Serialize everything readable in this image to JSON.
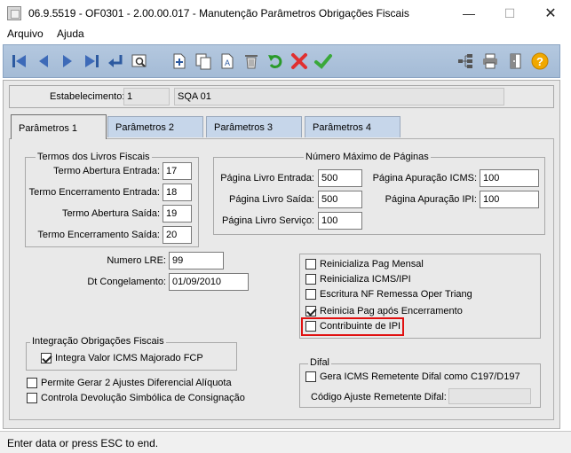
{
  "window": {
    "title": "06.9.5519 - OF0301 - 2.00.00.017 - Manutenção Parâmetros Obrigações Fiscais"
  },
  "menu": {
    "items": [
      "Arquivo",
      "Ajuda"
    ]
  },
  "toolbar": {
    "icons": [
      "first-record-icon",
      "previous-record-icon",
      "next-record-icon",
      "last-record-icon",
      "return-icon",
      "view-icon",
      "new-icon",
      "copy-icon",
      "edit-icon",
      "delete-icon",
      "undo-icon",
      "cancel-icon",
      "confirm-icon",
      "tree-icon",
      "print-icon",
      "exit-icon",
      "help-icon"
    ]
  },
  "header": {
    "estab_label": "Estabelecimento:",
    "estab_code": "1",
    "estab_name": "SQA 01"
  },
  "tabs": [
    {
      "label": "Parâmetros 1"
    },
    {
      "label": "Parâmetros 2"
    },
    {
      "label": "Parâmetros 3"
    },
    {
      "label": "Parâmetros 4"
    }
  ],
  "termos": {
    "title": "Termos dos Livros Fiscais",
    "rows": [
      {
        "label": "Termo Abertura Entrada:",
        "value": "17"
      },
      {
        "label": "Termo Encerramento Entrada:",
        "value": "18"
      },
      {
        "label": "Termo Abertura Saída:",
        "value": "19"
      },
      {
        "label": "Termo Encerramento Saída:",
        "value": "20"
      }
    ]
  },
  "paginas": {
    "title": "Número Máximo de Páginas",
    "left": [
      {
        "label": "Página Livro Entrada:",
        "value": "500"
      },
      {
        "label": "Página Livro Saída:",
        "value": "500"
      },
      {
        "label": "Página Livro Serviço:",
        "value": "100"
      }
    ],
    "right": [
      {
        "label": "Página  Apuração ICMS:",
        "value": "100"
      },
      {
        "label": "Página  Apuração IPI:",
        "value": "100"
      }
    ]
  },
  "lre": {
    "label": "Numero LRE:",
    "value": "99"
  },
  "congelamento": {
    "label": "Dt Congelamento:",
    "value": "01/09/2010"
  },
  "flags": [
    {
      "label": "Reinicializa Pag Mensal",
      "checked": false
    },
    {
      "label": "Reinicializa ICMS/IPI",
      "checked": false
    },
    {
      "label": "Escritura NF Remessa Oper Triang",
      "checked": false
    },
    {
      "label": "Reinicia Pag após Encerramento",
      "checked": true
    },
    {
      "label": "Contribuinte de IPI",
      "checked": false
    }
  ],
  "integracao": {
    "title": "Integração Obrigações Fiscais",
    "item": {
      "label": "Integra Valor ICMS Majorado FCP",
      "checked": true
    }
  },
  "ajustes": [
    {
      "label": "Permite Gerar 2 Ajustes Diferencial Alíquota",
      "checked": false
    },
    {
      "label": "Controla Devolução Simbólica de Consignação",
      "checked": false
    }
  ],
  "difal": {
    "title": "Difal",
    "item": {
      "label": "Gera ICMS Remetente Difal como C197/D197",
      "checked": false
    },
    "codigo_label": "Código Ajuste Remetente Difal:",
    "codigo_value": ""
  },
  "status": {
    "text": "Enter data or press ESC to end."
  },
  "colors": {
    "toolbar": "#a8bed8",
    "panel": "#e9e9e9",
    "highlight": "#e01010"
  }
}
